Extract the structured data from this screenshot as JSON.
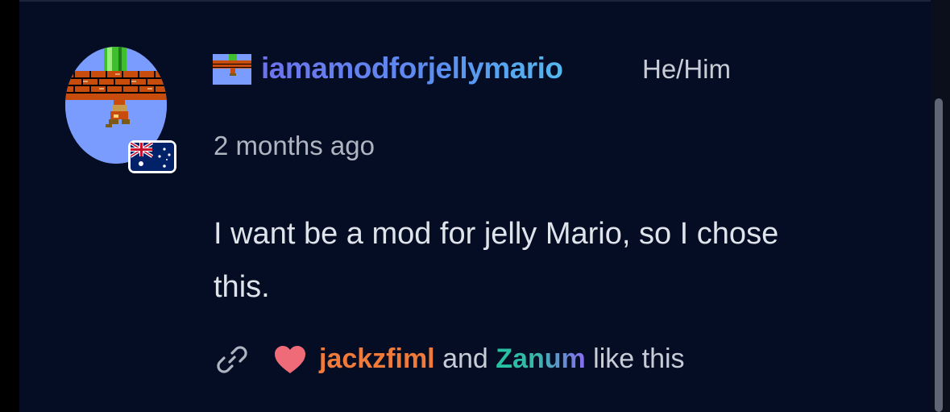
{
  "comment": {
    "username": "iamamodforjellymario",
    "pronouns": "He/Him",
    "timestamp": "2 months ago",
    "text": "I want be a mod for jelly Mario, so I chose this.",
    "country_flag": "australia-flag-icon"
  },
  "likes": {
    "user1": "jackzfiml",
    "and": "and",
    "user2": "Zanum",
    "suffix": "like this"
  },
  "colors": {
    "background": "#050d24",
    "username_gradient_start": "#6d72ee",
    "username_gradient_end": "#53b9ee",
    "like_user1": "#ef7a3a",
    "like_user2_start": "#22c3a0",
    "like_user2_end": "#8a6cf3",
    "heart": "#ef6b78"
  },
  "icons": {
    "link": "link-icon",
    "heart": "heart-icon"
  }
}
